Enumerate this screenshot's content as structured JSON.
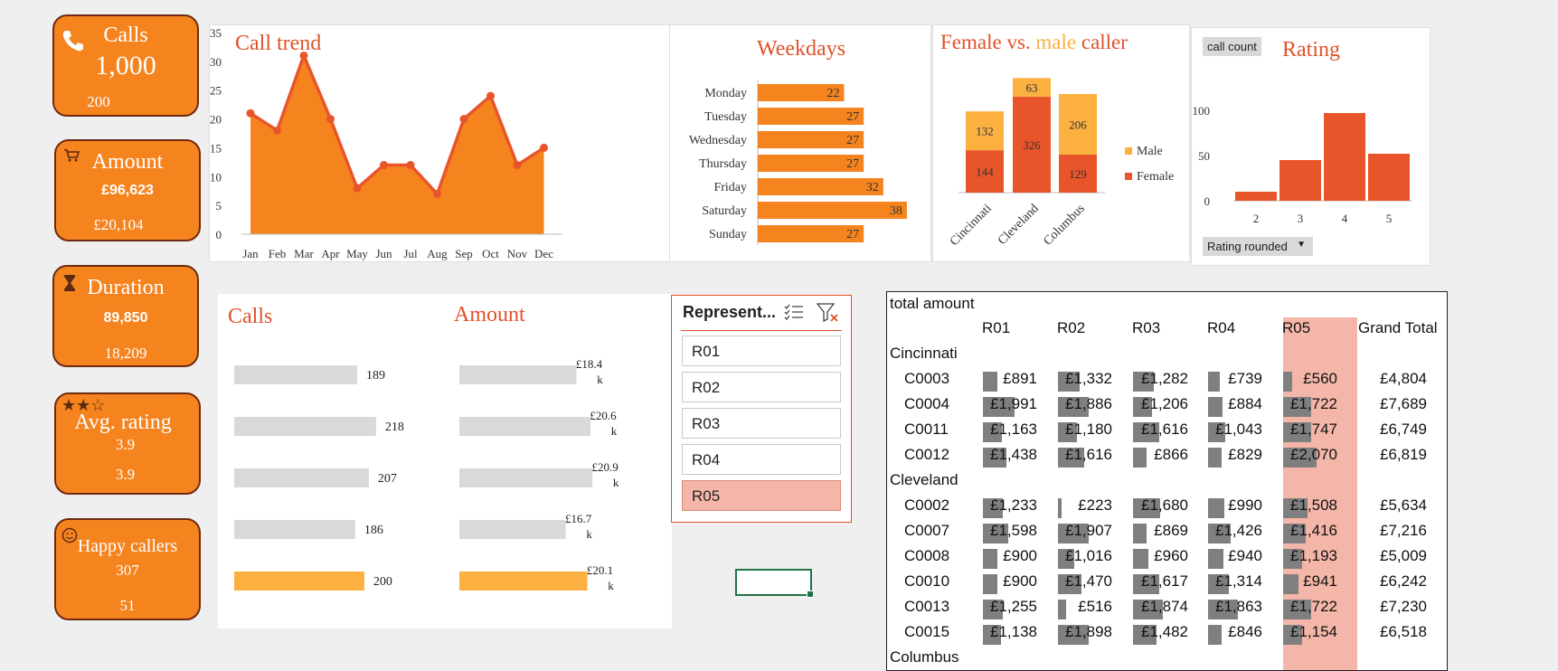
{
  "kpis": {
    "calls": {
      "title": "Calls",
      "value": "1,000",
      "sub": "200",
      "icon": "phone-icon"
    },
    "amount": {
      "title": "Amount",
      "value": "£96,623",
      "sub": "£20,104",
      "icon": "cart-icon"
    },
    "duration": {
      "title": "Duration",
      "value": "89,850",
      "sub": "18,209",
      "icon": "hourglass-icon"
    },
    "rating": {
      "title": "Avg. rating",
      "value": "3.9",
      "sub": "3.9",
      "icon": "stars-icon",
      "stars": "★★☆"
    },
    "happy": {
      "title": "Happy callers",
      "value": "307",
      "sub": "51",
      "icon": "smiley-icon"
    }
  },
  "call_trend": {
    "title": "Call trend",
    "chart_data": {
      "type": "area",
      "categories": [
        "Jan",
        "Feb",
        "Mar",
        "Apr",
        "May",
        "Jun",
        "Jul",
        "Aug",
        "Sep",
        "Oct",
        "Nov",
        "Dec"
      ],
      "values": [
        21,
        18,
        31,
        20,
        8,
        12,
        12,
        7,
        20,
        24,
        12,
        15
      ],
      "ylim": [
        0,
        35
      ],
      "yticks": [
        "0",
        "5",
        "10",
        "15",
        "20",
        "25",
        "30",
        "35"
      ],
      "color": "#f5841f",
      "line_color": "#e8552a"
    }
  },
  "weekdays": {
    "title": "Weekdays",
    "chart_data": {
      "type": "bar",
      "orientation": "horizontal",
      "categories": [
        "Monday",
        "Tuesday",
        "Wednesday",
        "Thursday",
        "Friday",
        "Saturday",
        "Sunday"
      ],
      "values": [
        22,
        27,
        27,
        27,
        32,
        38,
        27
      ],
      "labels": [
        "22",
        "27",
        "27",
        "27",
        "32",
        "38",
        "27"
      ],
      "color": "#f5841f"
    }
  },
  "gender": {
    "title_parts": {
      "a": "Female vs. ",
      "b": "male",
      "c": " caller"
    },
    "legend": {
      "male": "Male",
      "female": "Female"
    },
    "chart_data": {
      "type": "bar",
      "stacked": true,
      "categories": [
        "Cincinnati",
        "Cleveland",
        "Columbus"
      ],
      "series": [
        {
          "name": "Female",
          "values": [
            144,
            326,
            129
          ],
          "labels": [
            "144",
            "326",
            "129"
          ],
          "color": "#e8552a"
        },
        {
          "name": "Male",
          "values": [
            132,
            63,
            206
          ],
          "labels": [
            "132",
            "63",
            "206"
          ],
          "color": "#fbb040"
        }
      ]
    }
  },
  "rating_chart": {
    "title": "Rating",
    "button": "call count",
    "dropdown": "Rating rounded",
    "chart_data": {
      "type": "bar",
      "categories": [
        "2",
        "3",
        "4",
        "5"
      ],
      "values": [
        10,
        45,
        97,
        52
      ],
      "ylim": [
        0,
        110
      ],
      "yticks": [
        "0",
        "50",
        "100"
      ],
      "color": "#e8552a"
    }
  },
  "rep_calls": {
    "title": "Calls",
    "chart_data": {
      "type": "bar",
      "orientation": "horizontal",
      "categories": [
        "R01",
        "R02",
        "R03",
        "R04",
        "R05"
      ],
      "values": [
        189,
        218,
        207,
        186,
        200
      ],
      "labels": [
        "189",
        "218",
        "207",
        "186",
        "200"
      ],
      "colors": [
        "#d9d9d9",
        "#d9d9d9",
        "#d9d9d9",
        "#d9d9d9",
        "#fbb040"
      ]
    }
  },
  "rep_amount": {
    "title": "Amount",
    "chart_data": {
      "type": "bar",
      "orientation": "horizontal",
      "categories": [
        "R01",
        "R02",
        "R03",
        "R04",
        "R05"
      ],
      "values": [
        18.4,
        20.6,
        20.9,
        16.7,
        20.1
      ],
      "labels_top": [
        "£18.4",
        "£20.6",
        "£20.9",
        "£16.7",
        "£20.1"
      ],
      "labels_bottom": [
        "k",
        "k",
        "k",
        "k",
        "k"
      ],
      "colors": [
        "#d9d9d9",
        "#d9d9d9",
        "#d9d9d9",
        "#d9d9d9",
        "#fbb040"
      ]
    }
  },
  "slicer": {
    "header": "Represent...",
    "items": [
      {
        "label": "R01",
        "selected": false
      },
      {
        "label": "R02",
        "selected": false
      },
      {
        "label": "R03",
        "selected": false
      },
      {
        "label": "R04",
        "selected": false
      },
      {
        "label": "R05",
        "selected": true
      }
    ]
  },
  "pivot": {
    "title": "total amount",
    "columns": [
      "R01",
      "R02",
      "R03",
      "R04",
      "R05",
      "Grand Total"
    ],
    "groups": [
      {
        "name": "Cincinnati",
        "rows": [
          {
            "id": "C0003",
            "values": [
              891,
              1332,
              1282,
              739,
              560
            ],
            "labels": [
              "£891",
              "£1,332",
              "£1,282",
              "£739",
              "£560"
            ],
            "total": "£4,804"
          },
          {
            "id": "C0004",
            "values": [
              1991,
              1886,
              1206,
              884,
              1722
            ],
            "labels": [
              "£1,991",
              "£1,886",
              "£1,206",
              "£884",
              "£1,722"
            ],
            "total": "£7,689"
          },
          {
            "id": "C0011",
            "values": [
              1163,
              1180,
              1616,
              1043,
              1747
            ],
            "labels": [
              "£1,163",
              "£1,180",
              "£1,616",
              "£1,043",
              "£1,747"
            ],
            "total": "£6,749"
          },
          {
            "id": "C0012",
            "values": [
              1438,
              1616,
              866,
              829,
              2070
            ],
            "labels": [
              "£1,438",
              "£1,616",
              "£866",
              "£829",
              "£2,070"
            ],
            "total": "£6,819"
          }
        ]
      },
      {
        "name": "Cleveland",
        "rows": [
          {
            "id": "C0002",
            "values": [
              1233,
              223,
              1680,
              990,
              1508
            ],
            "labels": [
              "£1,233",
              "£223",
              "£1,680",
              "£990",
              "£1,508"
            ],
            "total": "£5,634"
          },
          {
            "id": "C0007",
            "values": [
              1598,
              1907,
              869,
              1426,
              1416
            ],
            "labels": [
              "£1,598",
              "£1,907",
              "£869",
              "£1,426",
              "£1,416"
            ],
            "total": "£7,216"
          },
          {
            "id": "C0008",
            "values": [
              900,
              1016,
              960,
              940,
              1193
            ],
            "labels": [
              "£900",
              "£1,016",
              "£960",
              "£940",
              "£1,193"
            ],
            "total": "£5,009"
          },
          {
            "id": "C0010",
            "values": [
              900,
              1470,
              1617,
              1314,
              941
            ],
            "labels": [
              "£900",
              "£1,470",
              "£1,617",
              "£1,314",
              "£941"
            ],
            "total": "£6,242"
          },
          {
            "id": "C0013",
            "values": [
              1255,
              516,
              1874,
              1863,
              1722
            ],
            "labels": [
              "£1,255",
              "£516",
              "£1,874",
              "£1,863",
              "£1,722"
            ],
            "total": "£7,230"
          },
          {
            "id": "C0015",
            "values": [
              1138,
              1898,
              1482,
              846,
              1154
            ],
            "labels": [
              "£1,138",
              "£1,898",
              "£1,482",
              "£846",
              "£1,154"
            ],
            "total": "£6,518"
          }
        ]
      },
      {
        "name": "Columbus",
        "rows": []
      }
    ]
  }
}
